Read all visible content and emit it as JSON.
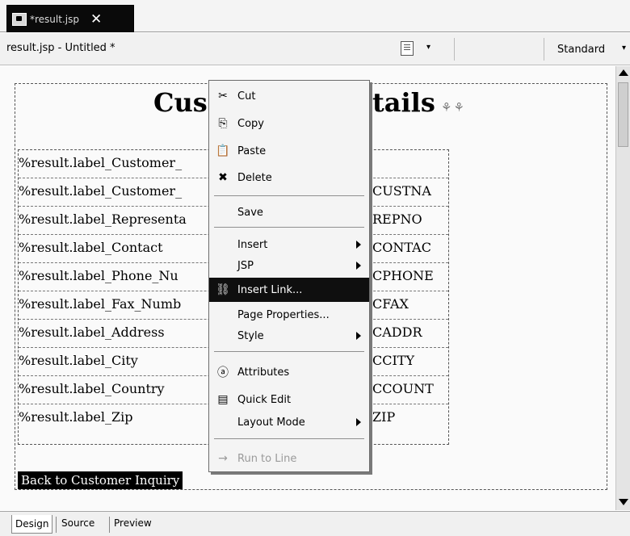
{
  "editor_tab": {
    "title": "*result.jsp"
  },
  "toolbar": {
    "doc_title": "result.jsp - Untitled *",
    "dropdown_arrow": "▾",
    "page_mode": "Standard"
  },
  "page": {
    "title_left": "Cus",
    "title_right": "tails",
    "title_marker": "⚘⚘",
    "rows": [
      {
        "label": "%result.label_Customer_",
        "value": ""
      },
      {
        "label": "%result.label_Customer_",
        "value": "CUSTNA"
      },
      {
        "label": "%result.label_Representa",
        "value": "REPNO"
      },
      {
        "label": "%result.label_Contact",
        "value": "CONTAC"
      },
      {
        "label": "%result.label_Phone_Nu",
        "value": "CPHONE"
      },
      {
        "label": "%result.label_Fax_Numb",
        "value": "CFAX"
      },
      {
        "label": "%result.label_Address",
        "value": "CADDR"
      },
      {
        "label": "%result.label_City",
        "value": "CCITY"
      },
      {
        "label": "%result.label_Country",
        "value": "CCOUNT"
      },
      {
        "label": "%result.label_Zip",
        "value": "ZIP"
      }
    ],
    "back_link": "Back to Customer Inquiry"
  },
  "context_menu": {
    "items": [
      {
        "label": "Cut",
        "icon": "scissors-icon",
        "glyph": "✂"
      },
      {
        "label": "Copy",
        "icon": "copy-icon",
        "glyph": "⎘"
      },
      {
        "label": "Paste",
        "icon": "paste-icon",
        "glyph": "📋"
      },
      {
        "label": "Delete",
        "icon": "delete-icon",
        "glyph": "✖"
      },
      {
        "label": "Save"
      },
      {
        "label": "Insert",
        "submenu": true
      },
      {
        "label": "JSP",
        "submenu": true
      },
      {
        "label": "Insert Link...",
        "icon": "link-icon",
        "glyph": "⛓",
        "highlighted": true
      },
      {
        "label": "Page Properties..."
      },
      {
        "label": "Style",
        "submenu": true
      },
      {
        "label": "Attributes",
        "icon": "attributes-icon",
        "glyph": "ⓐ"
      },
      {
        "label": "Quick Edit",
        "icon": "quick-edit-icon",
        "glyph": "▤"
      },
      {
        "label": "Layout Mode",
        "submenu": true
      },
      {
        "label": "Run to Line",
        "icon": "run-to-line-icon",
        "glyph": "→",
        "disabled": true
      }
    ]
  },
  "bottom_tabs": [
    {
      "label": "Design",
      "active": true
    },
    {
      "label": "Source",
      "active": false
    },
    {
      "label": "Preview",
      "active": false
    }
  ],
  "colors": {
    "highlight": "#0f0f0f",
    "menu_bg": "#f4f4f4",
    "canvas_bg": "#fafafa"
  }
}
